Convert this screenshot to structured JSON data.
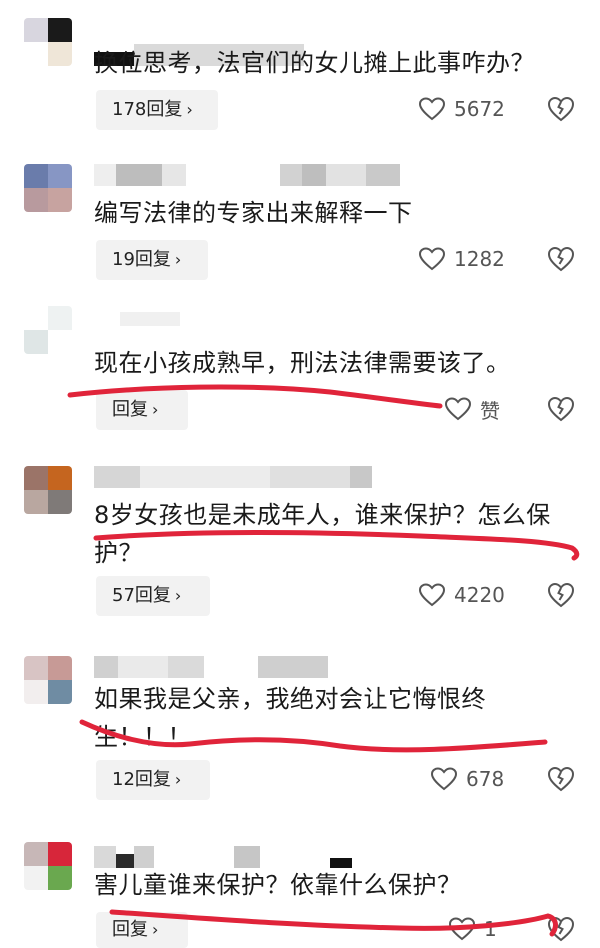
{
  "comments": [
    {
      "text": "换位思考，法官们的女儿摊上此事咋办？",
      "reply_label": "178回复",
      "like_count": "5672"
    },
    {
      "text": "编写法律的专家出来解释一下",
      "reply_label": "19回复",
      "like_count": "1282"
    },
    {
      "text": "现在小孩成熟早，刑法法律需要该了。",
      "reply_label": "回复",
      "like_count": "赞"
    },
    {
      "text": "8岁女孩也是未成年人，谁来保护？怎么保护？",
      "reply_label": "57回复",
      "like_count": "4220"
    },
    {
      "text": "如果我是父亲，我绝对会让它悔恨终生！！！",
      "reply_label": "12回复",
      "like_count": "678"
    },
    {
      "text": "害儿童谁来保护？依靠什么保护？",
      "reply_label": "回复",
      "like_count": "1"
    }
  ],
  "icons": {
    "chevron": "chevron-right-icon",
    "like": "heart-icon",
    "dislike": "broken-heart-icon"
  },
  "colors": {
    "annotation_red": "#e0243a"
  }
}
